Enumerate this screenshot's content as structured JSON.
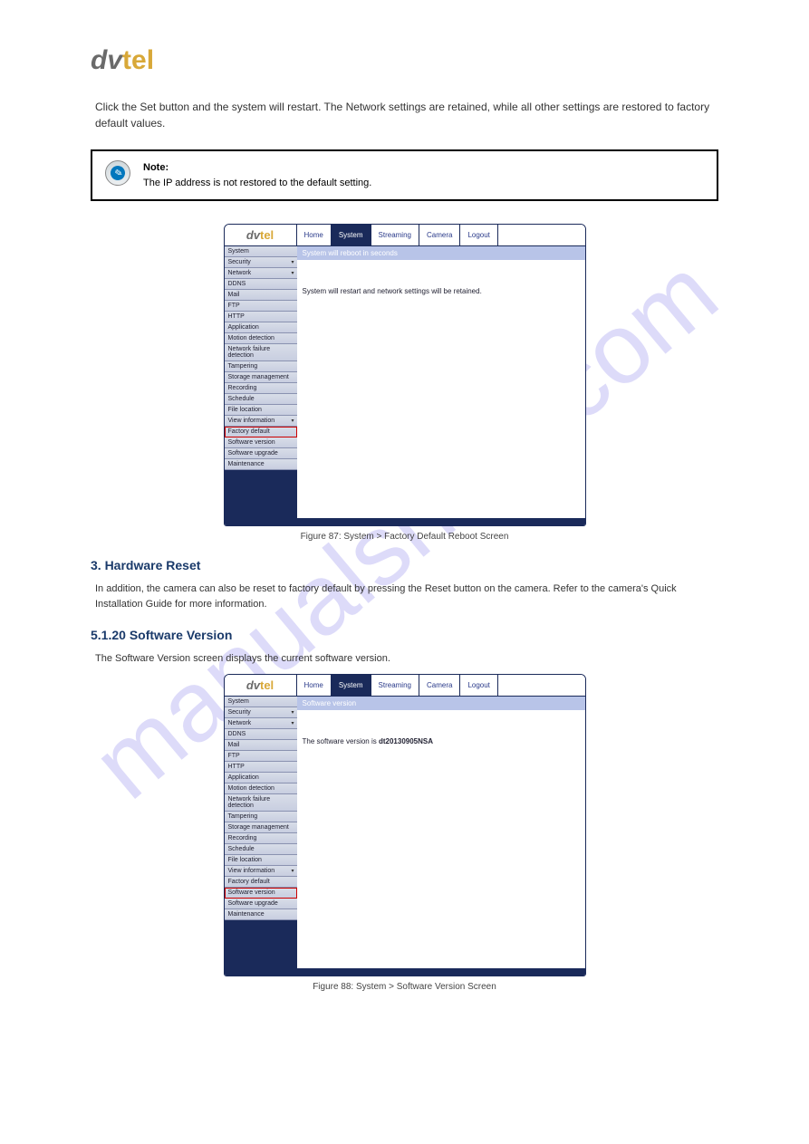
{
  "logo": {
    "part1": "dv",
    "part2": "tel"
  },
  "intro": "Click the Set button and the system will restart. The Network settings are retained, while all other settings are restored to factory default values.",
  "note": {
    "label": "Note:",
    "text": "The IP address is not restored to the default setting."
  },
  "screenshot1": {
    "tabs": [
      "Home",
      "System",
      "Streaming",
      "Camera",
      "Logout",
      ""
    ],
    "activeTab": "System",
    "sidebar": [
      {
        "label": "System"
      },
      {
        "label": "Security",
        "arrow": true
      },
      {
        "label": "Network",
        "arrow": true
      },
      {
        "label": "DDNS"
      },
      {
        "label": "Mail"
      },
      {
        "label": "FTP"
      },
      {
        "label": "HTTP"
      },
      {
        "label": "Application"
      },
      {
        "label": "Motion detection"
      },
      {
        "label": "Network failure detection"
      },
      {
        "label": "Tampering"
      },
      {
        "label": "Storage management"
      },
      {
        "label": "Recording"
      },
      {
        "label": "Schedule"
      },
      {
        "label": "File location"
      },
      {
        "label": "View information",
        "arrow": true
      },
      {
        "label": "Factory default",
        "highlight": true
      },
      {
        "label": "Software version"
      },
      {
        "label": "Software upgrade"
      },
      {
        "label": "Maintenance"
      }
    ],
    "panelTitle": "System will reboot in seconds",
    "panelBody": "System will restart and network settings will be retained."
  },
  "caption1": "Figure 87: System > Factory Default Reboot Screen",
  "step3": {
    "title": "3. Hardware Reset",
    "body": "In addition, the camera can also be reset to factory default by pressing the Reset button on the camera. Refer to the camera's Quick Installation Guide for more information."
  },
  "sectionSV": {
    "title": "5.1.20 Software Version",
    "body": "The Software Version screen displays the current software version."
  },
  "screenshot2": {
    "tabs": [
      "Home",
      "System",
      "Streaming",
      "Camera",
      "Logout",
      ""
    ],
    "activeTab": "System",
    "sidebar": [
      {
        "label": "System"
      },
      {
        "label": "Security",
        "arrow": true
      },
      {
        "label": "Network",
        "arrow": true
      },
      {
        "label": "DDNS"
      },
      {
        "label": "Mail"
      },
      {
        "label": "FTP"
      },
      {
        "label": "HTTP"
      },
      {
        "label": "Application"
      },
      {
        "label": "Motion detection"
      },
      {
        "label": "Network failure detection"
      },
      {
        "label": "Tampering"
      },
      {
        "label": "Storage management"
      },
      {
        "label": "Recording"
      },
      {
        "label": "Schedule"
      },
      {
        "label": "File location"
      },
      {
        "label": "View information",
        "arrow": true
      },
      {
        "label": "Factory default"
      },
      {
        "label": "Software version",
        "highlight": true
      },
      {
        "label": "Software upgrade"
      },
      {
        "label": "Maintenance"
      }
    ],
    "panelTitle": "Software version",
    "panelBodyPrefix": "The software version is ",
    "panelBodyVersion": "dt20130905NSA"
  },
  "caption2": "Figure 88: System > Software Version Screen"
}
